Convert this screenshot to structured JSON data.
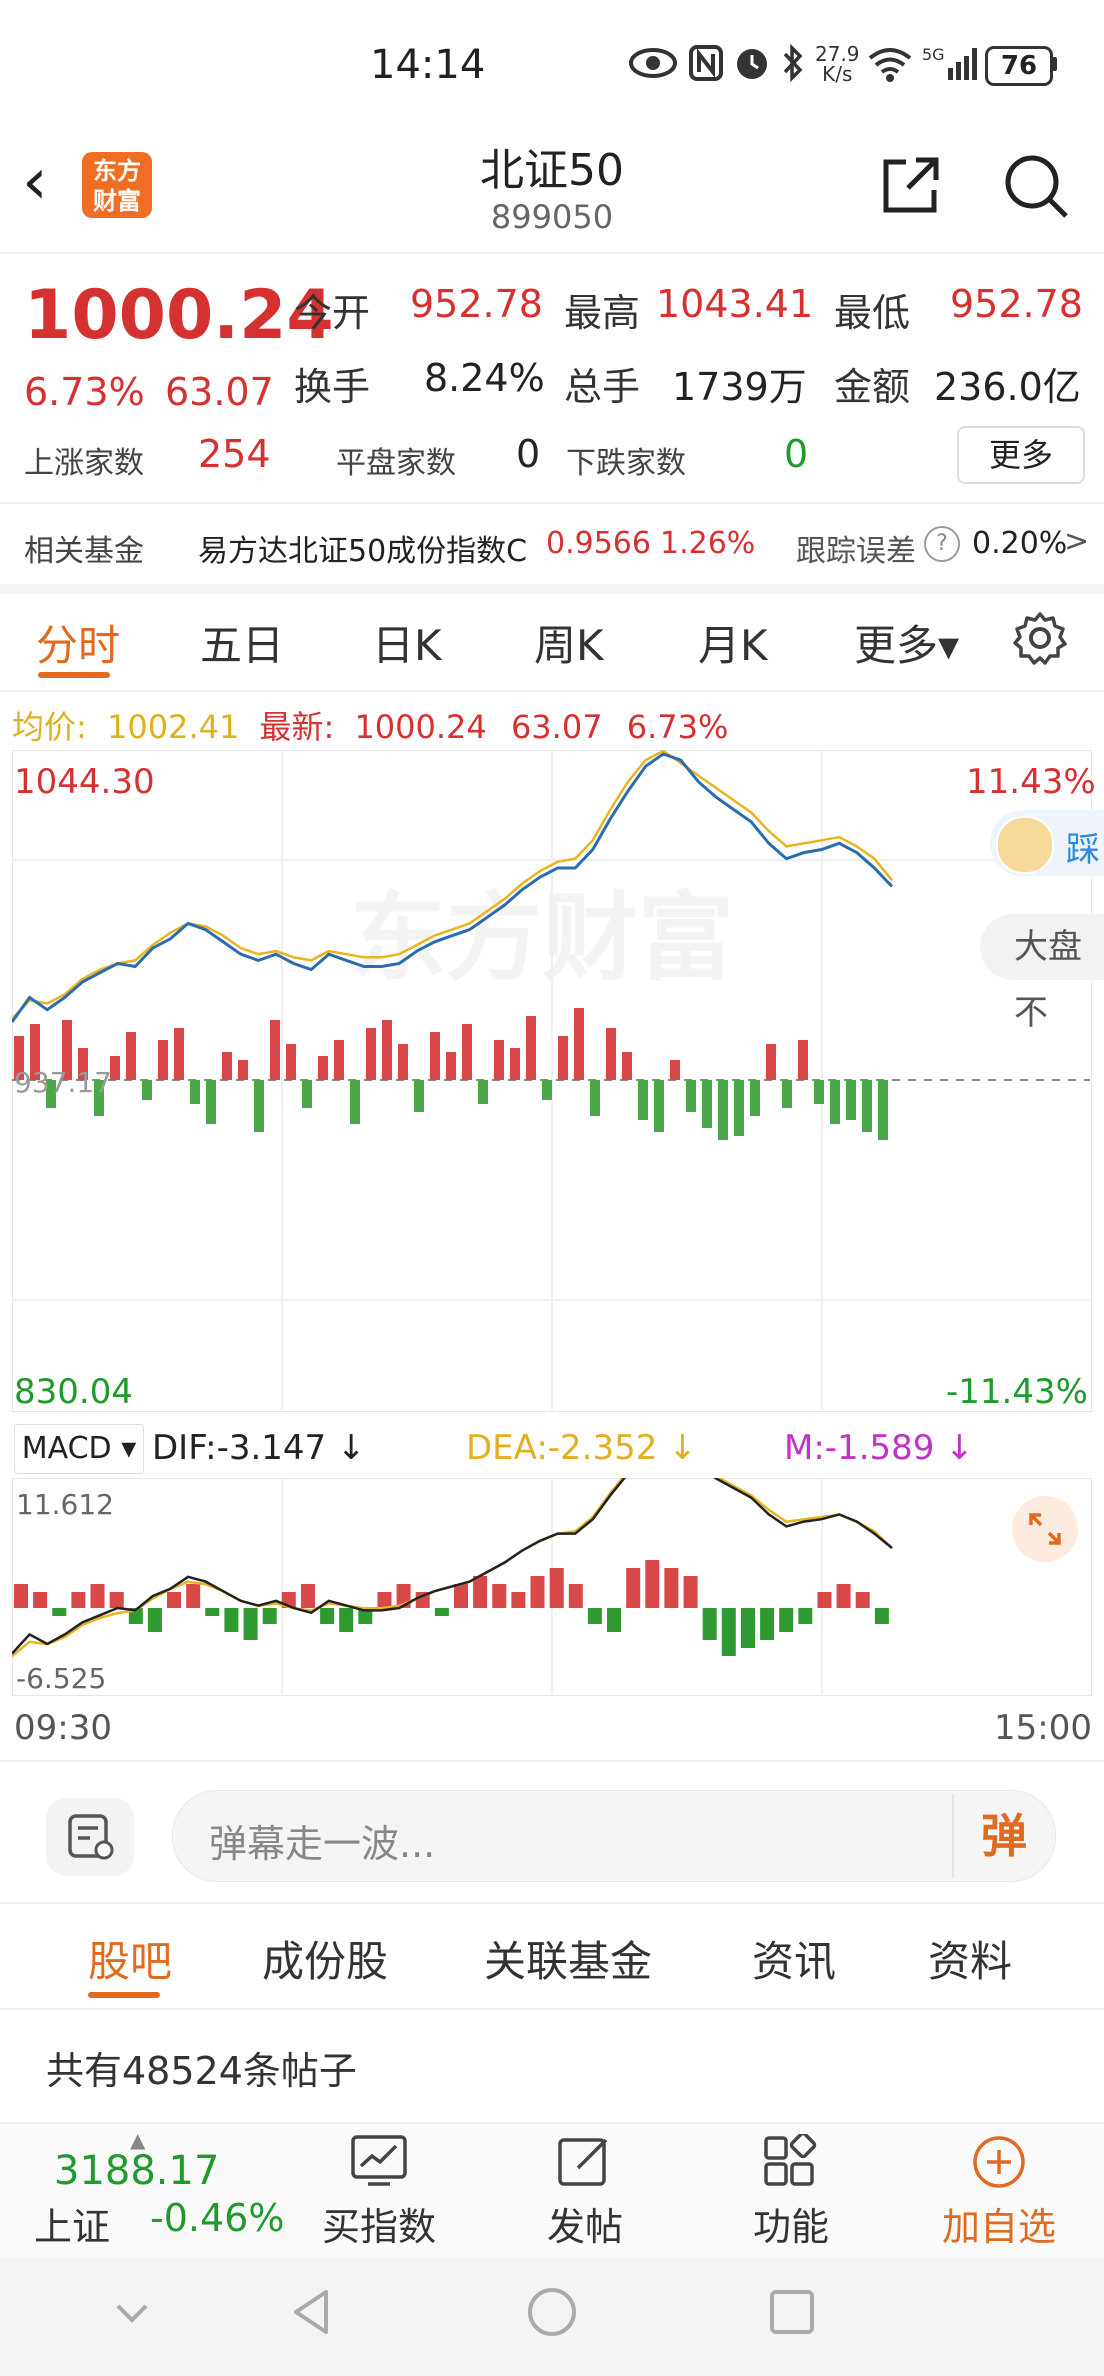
{
  "status_bar": {
    "time": "14:14",
    "net_speed": "27.9",
    "net_unit": "K/s",
    "battery": "76"
  },
  "header": {
    "logo_text_line1": "东方",
    "logo_text_line2": "财富",
    "title": "北证50",
    "code": "899050"
  },
  "quote": {
    "price": "1000.24",
    "change_pct": "6.73%",
    "change": "63.07",
    "open_label": "今开",
    "open": "952.78",
    "high_label": "最高",
    "high": "1043.41",
    "low_label": "最低",
    "low": "952.78",
    "turnover_label": "换手",
    "turnover": "8.24%",
    "volume_label": "总手",
    "volume": "1739万",
    "amount_label": "金额",
    "amount": "236.0亿",
    "up_label": "上涨家数",
    "up": "254",
    "flat_label": "平盘家数",
    "flat": "0",
    "down_label": "下跌家数",
    "down": "0",
    "more_label": "更多"
  },
  "fund": {
    "label": "相关基金",
    "name": "易方达北证50成份指数C",
    "value": "0.9566",
    "pct": "1.26%",
    "track_label": "跟踪误差",
    "track_value": "0.20%",
    "arrow": ">"
  },
  "tabs": [
    "分时",
    "五日",
    "日K",
    "周K",
    "月K",
    "更多▾"
  ],
  "chart_header": {
    "avg_label": "均价:",
    "avg_value": "1002.41",
    "latest_label": "最新:",
    "latest_value": "1000.24",
    "latest_change": "63.07",
    "latest_pct": "6.73%"
  },
  "chart_data": {
    "type": "line",
    "ylim": [
      830.04,
      1044.3
    ],
    "y_top_label": "1044.30",
    "y_bottom_label": "830.04",
    "y_mid_label": "937.17",
    "pct_top_label": "11.43%",
    "pct_bottom_label": "-11.43%",
    "x_start_label": "09:30",
    "x_end_label": "15:00",
    "watermark": "东方财富",
    "side_button": "大盘不",
    "side_badge": "踩",
    "series": [
      {
        "name": "price",
        "values": [
          956,
          964,
          960,
          964,
          969,
          972,
          975,
          974,
          980,
          983,
          988,
          986,
          982,
          978,
          976,
          978,
          975,
          973,
          978,
          976,
          974,
          974,
          975,
          979,
          982,
          984,
          986,
          990,
          994,
          999,
          1003,
          1006,
          1006,
          1012,
          1022,
          1031,
          1039,
          1043,
          1041,
          1034,
          1029,
          1025,
          1021,
          1014,
          1009,
          1011,
          1012,
          1014,
          1011,
          1006,
          1000
        ]
      },
      {
        "name": "avg",
        "values": [
          957,
          963,
          962,
          965,
          970,
          973,
          975,
          976,
          981,
          985,
          988,
          987,
          984,
          980,
          978,
          979,
          977,
          976,
          979,
          978,
          977,
          977,
          978,
          981,
          984,
          986,
          988,
          992,
          996,
          1001,
          1005,
          1008,
          1009,
          1015,
          1025,
          1034,
          1041,
          1044,
          1040,
          1036,
          1032,
          1028,
          1024,
          1018,
          1013,
          1014,
          1015,
          1016,
          1013,
          1009,
          1002
        ]
      }
    ],
    "volume": [
      22,
      28,
      -14,
      30,
      16,
      -18,
      12,
      24,
      -10,
      20,
      26,
      -12,
      -22,
      14,
      10,
      -26,
      30,
      18,
      -14,
      12,
      20,
      -22,
      26,
      30,
      18,
      -16,
      24,
      14,
      28,
      -12,
      20,
      16,
      32,
      -10,
      22,
      36,
      -18,
      26,
      14,
      -20,
      -26,
      10,
      -16,
      -24,
      -30,
      -28,
      -18,
      18,
      -14,
      20,
      -12,
      -22,
      -20,
      -26,
      -30
    ]
  },
  "macd": {
    "label": "MACD ▾",
    "dif": "DIF:-3.147 ↓",
    "dea": "DEA:-2.352 ↓",
    "m": "M:-1.589 ↓",
    "ylim_top": "11.612",
    "ylim_bottom": "-6.525",
    "bars": [
      3,
      2,
      -1,
      2,
      3,
      2,
      -2,
      -3,
      2,
      3,
      -1,
      -3,
      -4,
      -2,
      2,
      3,
      -2,
      -3,
      -2,
      2,
      3,
      2,
      -1,
      3,
      4,
      3,
      2,
      4,
      5,
      3,
      -2,
      -3,
      5,
      6,
      5,
      4,
      -4,
      -6,
      -5,
      -4,
      -3,
      -2,
      2,
      3,
      2,
      -2
    ]
  },
  "danmu": {
    "placeholder": "弹幕走一波...",
    "button": "弹"
  },
  "bottom_tabs": [
    "股吧",
    "成份股",
    "关联基金",
    "资讯",
    "资料"
  ],
  "posts_count": "共有48524条帖子",
  "bottom_bar": {
    "index_value": "3188.17",
    "index_name": "上证",
    "index_pct": "-0.46%",
    "buy_index": "买指数",
    "post": "发帖",
    "features": "功能",
    "add_watch": "加自选"
  },
  "colors": {
    "up": "#d63131",
    "down": "#1f9a2c",
    "accent": "#e06a1f",
    "price_line": "#2a6cb0",
    "avg_line": "#e8b520"
  }
}
